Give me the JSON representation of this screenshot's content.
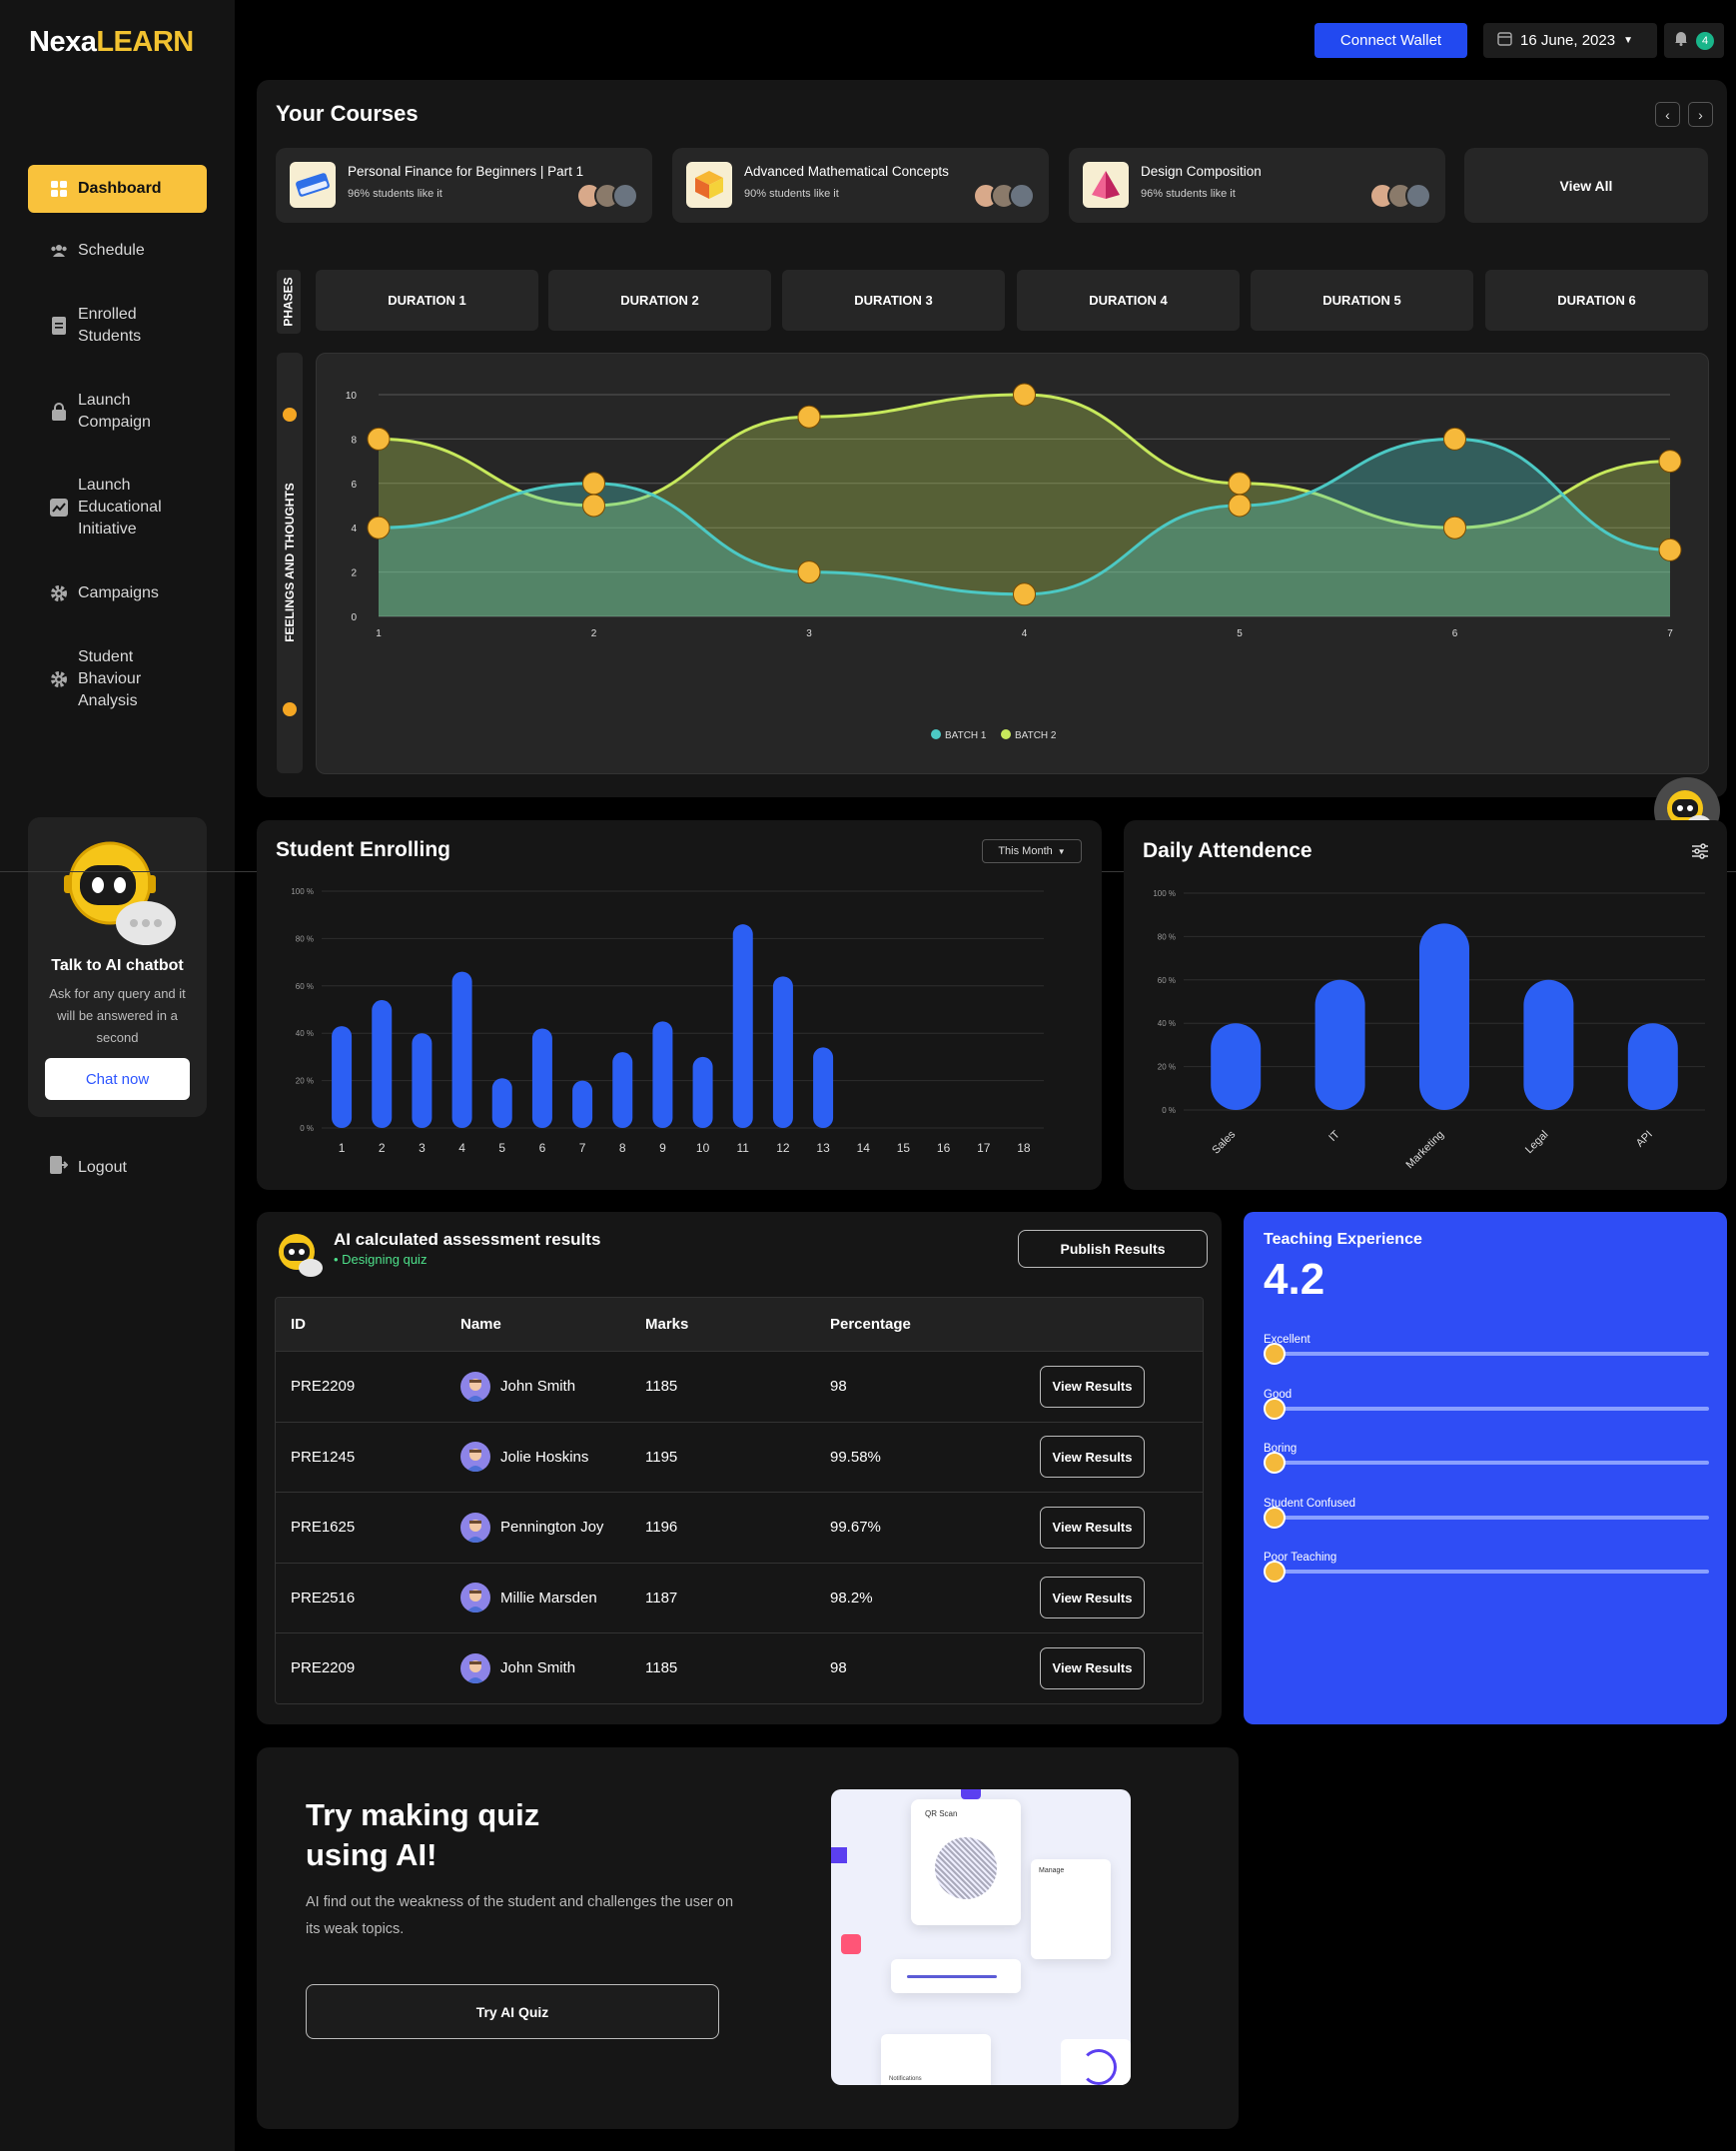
{
  "brand": {
    "part1": "Nexa",
    "part2": "LEARN"
  },
  "sidebar": {
    "items": [
      {
        "label": "Dashboard",
        "icon": "grid-icon"
      },
      {
        "label": "Schedule",
        "icon": "users-icon"
      },
      {
        "label": "Enrolled Students",
        "icon": "document-icon"
      },
      {
        "label": "Launch Compaign",
        "icon": "lock-icon"
      },
      {
        "label": "Launch Educational Initiative",
        "icon": "chart-icon"
      },
      {
        "label": "Campaigns",
        "icon": "gear-icon"
      },
      {
        "label": "Student Bhaviour Analysis",
        "icon": "gear-icon"
      }
    ],
    "chatbot": {
      "title": "Talk to AI chatbot",
      "desc": "Ask for any query and it will be answered in a second",
      "button": "Chat now"
    },
    "logout": "Logout"
  },
  "topbar": {
    "wallet": "Connect Wallet",
    "date": "16 June, 2023",
    "notifications": "4"
  },
  "courses": {
    "title": "Your Courses",
    "items": [
      {
        "title": "Personal Finance for Beginners | Part 1",
        "stat": "96% students like it"
      },
      {
        "title": "Advanced Mathematical Concepts",
        "stat": "90% students like it"
      },
      {
        "title": "Design Composition",
        "stat": "96% students like it"
      }
    ],
    "view_all": "View All"
  },
  "phases": {
    "label": "PHASES",
    "durations": [
      "DURATION 1",
      "DURATION 2",
      "DURATION 3",
      "DURATION 4",
      "DURATION 5",
      "DURATION 6"
    ]
  },
  "feelings_label": "FEELINGS AND THOUGHTS",
  "enroll": {
    "title": "Student Enrolling",
    "filter": "This Month"
  },
  "attend": {
    "title": "Daily Attendence"
  },
  "chart_data": [
    {
      "type": "area",
      "x": [
        1,
        2,
        3,
        4,
        5,
        6,
        7
      ],
      "ylim": [
        0,
        10
      ],
      "yticks": [
        0,
        2,
        4,
        6,
        8,
        10
      ],
      "series": [
        {
          "name": "BATCH 1",
          "color": "#4cc9c4",
          "values": [
            4,
            6,
            2,
            1,
            5,
            8,
            3
          ]
        },
        {
          "name": "BATCH 2",
          "color": "#c7e95c",
          "values": [
            8,
            5,
            9,
            10,
            6,
            4,
            7
          ]
        }
      ],
      "legend": "bottom-center",
      "grid": true
    },
    {
      "type": "bar",
      "categories": [
        "1",
        "2",
        "3",
        "4",
        "5",
        "6",
        "7",
        "8",
        "9",
        "10",
        "11",
        "12",
        "13",
        "14",
        "15",
        "16",
        "17",
        "18"
      ],
      "values": [
        43,
        54,
        40,
        66,
        21,
        42,
        20,
        32,
        45,
        30,
        86,
        64,
        34,
        null,
        null,
        null,
        null,
        null
      ],
      "ylim": [
        0,
        100
      ],
      "yticks": [
        "0 %",
        "20 %",
        "40 %",
        "60 %",
        "80 %",
        "100 %"
      ],
      "color": "#2c5ff3",
      "grid": true
    },
    {
      "type": "bar",
      "categories": [
        "Sales",
        "IT",
        "Marketing",
        "Legal",
        "API"
      ],
      "values": [
        40,
        60,
        86,
        60,
        40
      ],
      "ylim": [
        0,
        100
      ],
      "yticks": [
        "0 %",
        "20 %",
        "40 %",
        "60 %",
        "80 %",
        "100 %"
      ],
      "color": "#2c5ff3",
      "grid": true
    }
  ],
  "assessment": {
    "title": "AI calculated assessment results",
    "subtitle": "• Designing quiz",
    "publish": "Publish Results",
    "columns": [
      "ID",
      "Name",
      "Marks",
      "Percentage"
    ],
    "rows": [
      {
        "id": "PRE2209",
        "name": "John Smith",
        "marks": "1185",
        "pct": "98",
        "action": "View Results"
      },
      {
        "id": "PRE1245",
        "name": "Jolie Hoskins",
        "marks": "1195",
        "pct": "99.58%",
        "action": "View Results"
      },
      {
        "id": "PRE1625",
        "name": "Pennington Joy",
        "marks": "1196",
        "pct": "99.67%",
        "action": "View Results"
      },
      {
        "id": "PRE2516",
        "name": "Millie Marsden",
        "marks": "1187",
        "pct": "98.2%",
        "action": "View Results"
      },
      {
        "id": "PRE2209",
        "name": "John Smith",
        "marks": "1185",
        "pct": "98",
        "action": "View Results"
      }
    ]
  },
  "teaching": {
    "title": "Teaching Experience",
    "score": "4.2",
    "rows": [
      "Excellent",
      "Good",
      "Boring",
      "Student Confused",
      "Poor Teaching"
    ]
  },
  "quiz": {
    "title": "Try making quiz using AI!",
    "desc": "AI find out the weakness of the student and challenges the user on its weak topics.",
    "button": "Try AI Quiz",
    "image_caption": "QR Scan",
    "image_manage": "Manage",
    "image_notifications": "Notifications"
  },
  "colors": {
    "accent": "#f9c23c",
    "primary": "#2249f0",
    "panel": "#161616"
  }
}
